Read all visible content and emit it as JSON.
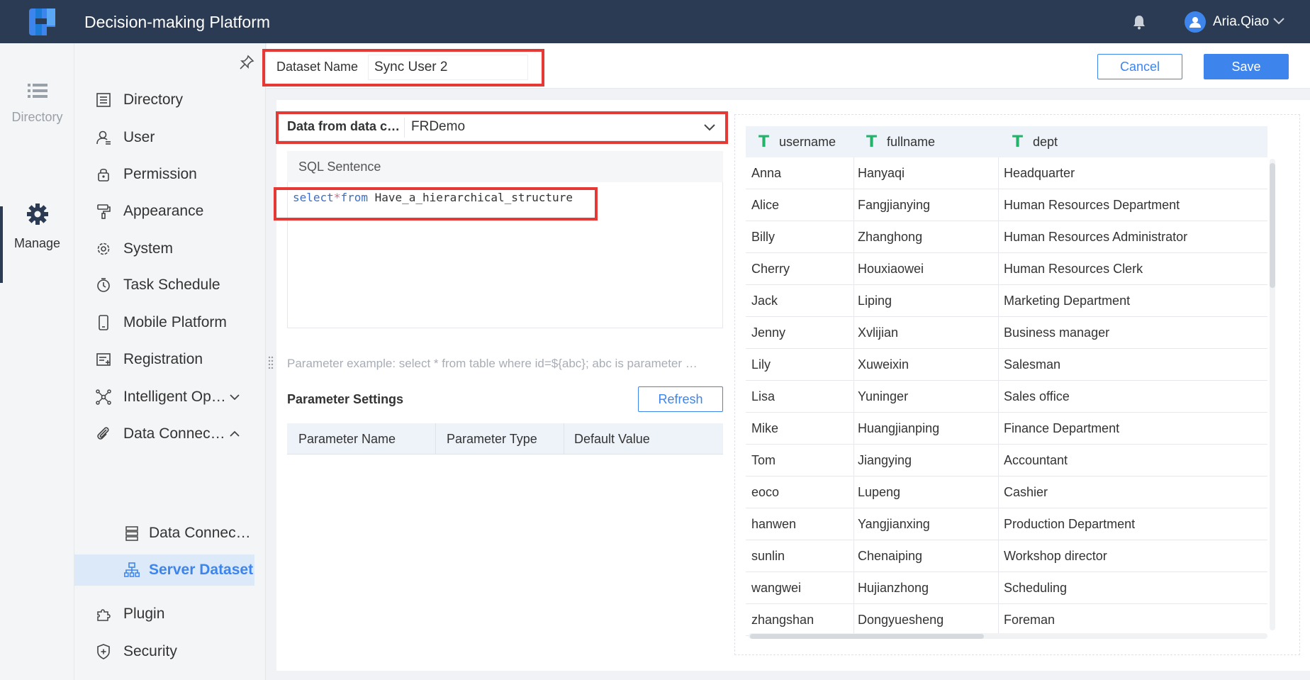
{
  "header": {
    "title": "Decision-making Platform",
    "user_name": "Aria.Qiao"
  },
  "rail": {
    "directory_label": "Directory",
    "manage_label": "Manage"
  },
  "sidebar": {
    "items": [
      {
        "label": "Directory",
        "icon": "directory-icon"
      },
      {
        "label": "User",
        "icon": "user-icon"
      },
      {
        "label": "Permission",
        "icon": "lock-icon"
      },
      {
        "label": "Appearance",
        "icon": "paint-roller-icon"
      },
      {
        "label": "System",
        "icon": "gear-icon"
      },
      {
        "label": "Task Schedule",
        "icon": "stopwatch-icon"
      },
      {
        "label": "Mobile Platform",
        "icon": "mobile-icon"
      },
      {
        "label": "Registration",
        "icon": "registration-icon"
      },
      {
        "label": "Intelligent Op…",
        "icon": "network-icon"
      },
      {
        "label": "Data Connec…",
        "icon": "link-icon"
      },
      {
        "label": "Plugin",
        "icon": "puzzle-icon"
      },
      {
        "label": "Security",
        "icon": "shield-icon"
      }
    ],
    "sub_items": [
      {
        "label": "Data Connec…",
        "icon": "database-icon"
      },
      {
        "label": "Server Dataset",
        "icon": "dataset-tree-icon"
      }
    ]
  },
  "toolbar": {
    "dataset_name_label": "Dataset Name",
    "dataset_name_value": "Sync User 2",
    "cancel_label": "Cancel",
    "save_label": "Save"
  },
  "editor": {
    "source_label": "Data from data c…",
    "source_value": "FRDemo",
    "sql_header": "SQL Sentence",
    "sql_select": "select",
    "sql_star": "*",
    "sql_from": "from",
    "sql_table": " Have_a_hierarchical_structure",
    "param_hint": "Parameter example: select * from table where id=${abc}; abc is parameter …",
    "param_title": "Parameter Settings",
    "refresh_label": "Refresh",
    "param_columns": [
      "Parameter Name",
      "Parameter Type",
      "Default Value"
    ]
  },
  "preview": {
    "columns": [
      "username",
      "fullname",
      "dept"
    ],
    "rows": [
      [
        "Anna",
        "Hanyaqi",
        "Headquarter"
      ],
      [
        "Alice",
        "Fangjianying",
        "Human Resources Department"
      ],
      [
        "Billy",
        "Zhanghong",
        "Human Resources Administrator"
      ],
      [
        "Cherry",
        "Houxiaowei",
        "Human Resources Clerk"
      ],
      [
        "Jack",
        "Liping",
        "Marketing Department"
      ],
      [
        "Jenny",
        "Xvlijian",
        "Business manager"
      ],
      [
        "Lily",
        "Xuweixin",
        "Salesman"
      ],
      [
        "Lisa",
        "Yuninger",
        "Sales office"
      ],
      [
        "Mike",
        "Huangjianping",
        "Finance Department"
      ],
      [
        "Tom",
        "Jiangying",
        "Accountant"
      ],
      [
        "eoco",
        "Lupeng",
        "Cashier"
      ],
      [
        "hanwen",
        "Yangjianxing",
        "Production Department"
      ],
      [
        "sunlin",
        "Chenaiping",
        "Workshop director"
      ],
      [
        "wangwei",
        "Hujianzhong",
        "Scheduling"
      ],
      [
        "zhangshan",
        "Dongyuesheng",
        "Foreman"
      ]
    ]
  },
  "colors": {
    "header_bg": "#2b3b53",
    "accent": "#3d85ed",
    "highlight_box": "#e53935",
    "text_type_icon": "#23b36b"
  }
}
